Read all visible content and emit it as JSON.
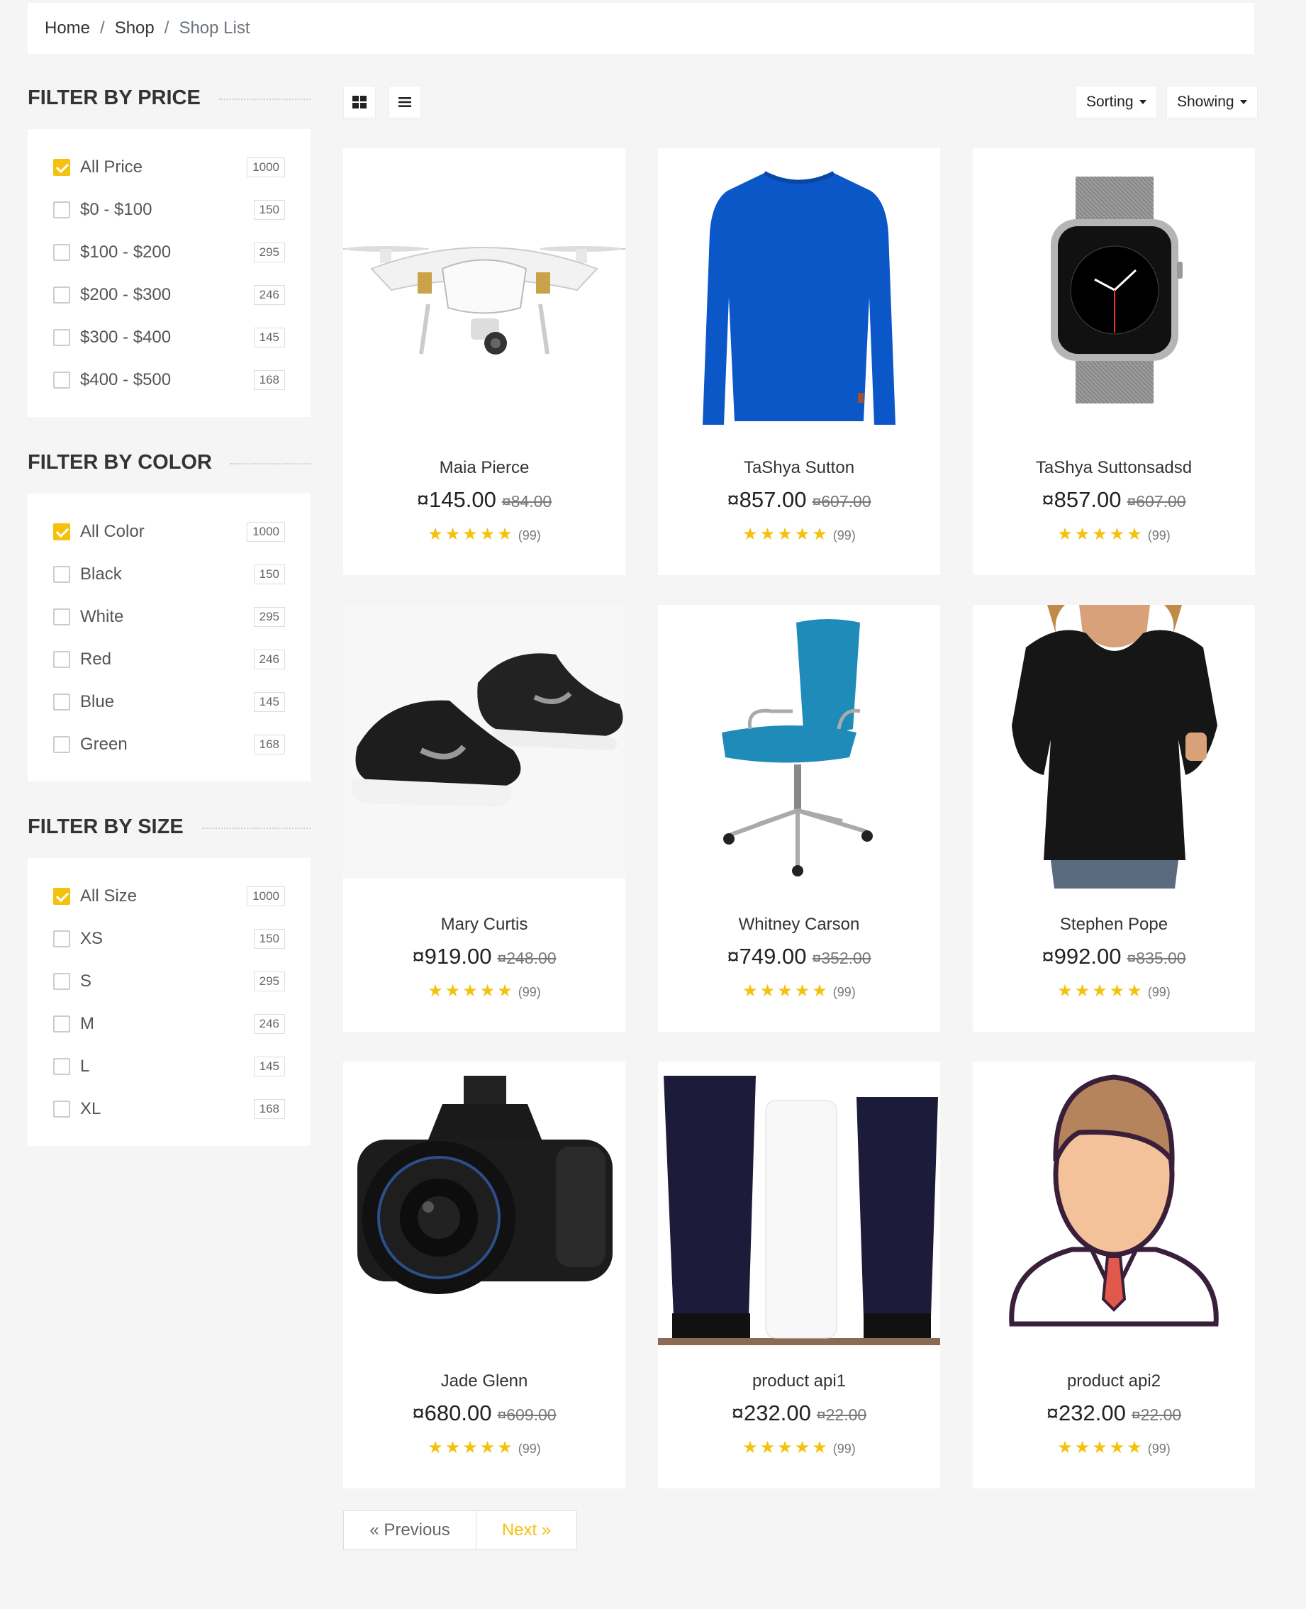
{
  "breadcrumb": {
    "home": "Home",
    "shop": "Shop",
    "current": "Shop List",
    "separator": "/"
  },
  "filters": [
    {
      "title": "FILTER BY PRICE",
      "items": [
        {
          "label": "All Price",
          "count": "1000",
          "checked": true
        },
        {
          "label": "$0 - $100",
          "count": "150",
          "checked": false
        },
        {
          "label": "$100 - $200",
          "count": "295",
          "checked": false
        },
        {
          "label": "$200 - $300",
          "count": "246",
          "checked": false
        },
        {
          "label": "$300 - $400",
          "count": "145",
          "checked": false
        },
        {
          "label": "$400 - $500",
          "count": "168",
          "checked": false
        }
      ]
    },
    {
      "title": "FILTER BY COLOR",
      "items": [
        {
          "label": "All Color",
          "count": "1000",
          "checked": true
        },
        {
          "label": "Black",
          "count": "150",
          "checked": false
        },
        {
          "label": "White",
          "count": "295",
          "checked": false
        },
        {
          "label": "Red",
          "count": "246",
          "checked": false
        },
        {
          "label": "Blue",
          "count": "145",
          "checked": false
        },
        {
          "label": "Green",
          "count": "168",
          "checked": false
        }
      ]
    },
    {
      "title": "FILTER BY SIZE",
      "items": [
        {
          "label": "All Size",
          "count": "1000",
          "checked": true
        },
        {
          "label": "XS",
          "count": "150",
          "checked": false
        },
        {
          "label": "S",
          "count": "295",
          "checked": false
        },
        {
          "label": "M",
          "count": "246",
          "checked": false
        },
        {
          "label": "L",
          "count": "145",
          "checked": false
        },
        {
          "label": "XL",
          "count": "168",
          "checked": false
        }
      ]
    }
  ],
  "toolbar": {
    "grid_view_icon": "grid-view-icon",
    "list_view_icon": "list-view-icon",
    "sorting_label": "Sorting",
    "showing_label": "Showing"
  },
  "products": [
    {
      "name": "Maia Pierce",
      "price": "¤145.00",
      "old_price": "¤84.00",
      "rating": 5,
      "reviews": "(99)",
      "image": "drone"
    },
    {
      "name": "TaShya Sutton",
      "price": "¤857.00",
      "old_price": "¤607.00",
      "rating": 5,
      "reviews": "(99)",
      "image": "sweater"
    },
    {
      "name": "TaShya Suttonsadsd",
      "price": "¤857.00",
      "old_price": "¤607.00",
      "rating": 5,
      "reviews": "(99)",
      "image": "watch"
    },
    {
      "name": "Mary Curtis",
      "price": "¤919.00",
      "old_price": "¤248.00",
      "rating": 5,
      "reviews": "(99)",
      "image": "sneakers"
    },
    {
      "name": "Whitney Carson",
      "price": "¤749.00",
      "old_price": "¤352.00",
      "rating": 5,
      "reviews": "(99)",
      "image": "chair"
    },
    {
      "name": "Stephen Pope",
      "price": "¤992.00",
      "old_price": "¤835.00",
      "rating": 5,
      "reviews": "(99)",
      "image": "blouse"
    },
    {
      "name": "Jade Glenn",
      "price": "¤680.00",
      "old_price": "¤609.00",
      "rating": 5,
      "reviews": "(99)",
      "image": "camera"
    },
    {
      "name": "product api1",
      "price": "¤232.00",
      "old_price": "¤22.00",
      "rating": 5,
      "reviews": "(99)",
      "image": "skincare"
    },
    {
      "name": "product api2",
      "price": "¤232.00",
      "old_price": "¤22.00",
      "rating": 5,
      "reviews": "(99)",
      "image": "avatar"
    }
  ],
  "pagination": {
    "previous": "« Previous",
    "next": "Next »"
  },
  "colors": {
    "accent": "#f4c20d",
    "background": "#f5f5f5",
    "card": "#ffffff"
  }
}
